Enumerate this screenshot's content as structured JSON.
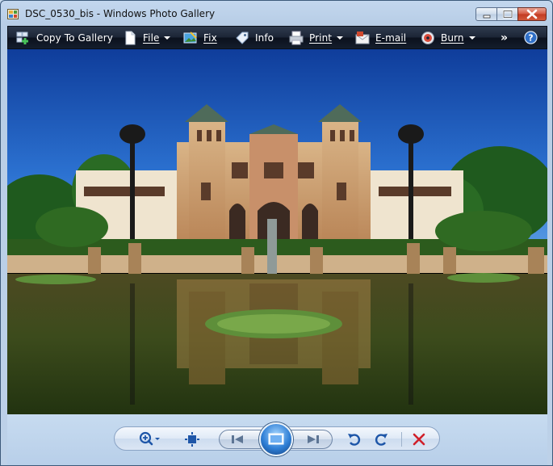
{
  "window": {
    "title": "DSC_0530_bis - Windows Photo Gallery"
  },
  "toolbar": {
    "items": [
      {
        "label": "Copy To Gallery",
        "icon": "copy-to-gallery-icon"
      },
      {
        "label": "File",
        "icon": "file-icon",
        "dropdown": true
      },
      {
        "label": "Fix",
        "icon": "fix-icon"
      },
      {
        "label": "Info",
        "icon": "info-tag-icon"
      },
      {
        "label": "Print",
        "icon": "printer-icon",
        "dropdown": true
      },
      {
        "label": "E-mail",
        "icon": "email-icon"
      },
      {
        "label": "Burn",
        "icon": "burn-disc-icon",
        "dropdown": true
      }
    ],
    "more": "»"
  },
  "photo": {
    "subject": "palace-reflection-photo"
  },
  "controls": {
    "buttons": [
      "zoom",
      "actual-size",
      "previous",
      "slideshow",
      "next",
      "rotate-counterclockwise",
      "rotate-clockwise",
      "delete"
    ]
  },
  "colors": {
    "toolbar_bg": "#1c2536",
    "accent": "#2f7fd6",
    "delete": "#d0202a"
  }
}
